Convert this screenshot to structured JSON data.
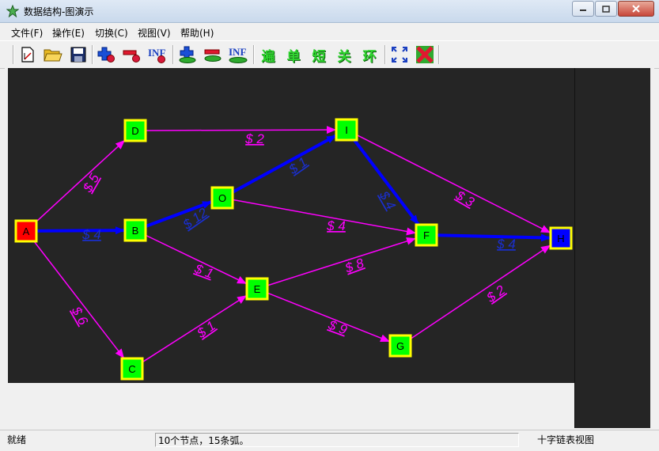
{
  "window": {
    "title": "数据结构-图演示",
    "app_icon": "green-star-icon",
    "buttons": {
      "minimize": "minimize-icon",
      "maximize": "maximize-icon",
      "close": "close-icon"
    }
  },
  "menu": [
    {
      "label": "文件(F)"
    },
    {
      "label": "操作(E)"
    },
    {
      "label": "切换(C)"
    },
    {
      "label": "视图(V)"
    },
    {
      "label": "帮助(H)"
    }
  ],
  "toolbar": {
    "text_buttons": {
      "traverse": "遍",
      "single": "单",
      "shortest": "短",
      "critical": "关",
      "cycle": "环"
    },
    "inf_label": "INF"
  },
  "graph": {
    "colors": {
      "background": "#252525",
      "edge_normal": "#ff00ff",
      "edge_highlight": "#0000ff",
      "node_fill": "#00ff00",
      "node_border": "#ffff00",
      "node_start": "#ff0000",
      "node_end": "#0000ff"
    },
    "nodes": [
      {
        "id": "A",
        "role": "start"
      },
      {
        "id": "B",
        "role": "normal"
      },
      {
        "id": "C",
        "role": "normal"
      },
      {
        "id": "D",
        "role": "normal"
      },
      {
        "id": "E",
        "role": "normal"
      },
      {
        "id": "F",
        "role": "normal"
      },
      {
        "id": "G",
        "role": "normal"
      },
      {
        "id": "H",
        "role": "end"
      },
      {
        "id": "I",
        "role": "normal"
      },
      {
        "id": "O",
        "role": "normal"
      }
    ],
    "edges": [
      {
        "from": "A",
        "to": "D",
        "label": "$ 5",
        "highlight": false
      },
      {
        "from": "A",
        "to": "B",
        "label": "$ 4",
        "highlight": true
      },
      {
        "from": "A",
        "to": "C",
        "label": "$ 6",
        "highlight": false
      },
      {
        "from": "D",
        "to": "I",
        "label": "$ 2",
        "highlight": false
      },
      {
        "from": "B",
        "to": "O",
        "label": "$ 12",
        "highlight": true
      },
      {
        "from": "B",
        "to": "E",
        "label": "$ 1",
        "highlight": false
      },
      {
        "from": "C",
        "to": "E",
        "label": "$ 1",
        "highlight": false
      },
      {
        "from": "O",
        "to": "I",
        "label": "$ 1",
        "highlight": true
      },
      {
        "from": "O",
        "to": "F",
        "label": "$ 4",
        "highlight": false
      },
      {
        "from": "I",
        "to": "F",
        "label": "$ 4",
        "highlight": true
      },
      {
        "from": "I",
        "to": "H",
        "label": "$ 3",
        "highlight": false
      },
      {
        "from": "E",
        "to": "F",
        "label": "$ 8",
        "highlight": false
      },
      {
        "from": "E",
        "to": "G",
        "label": "$ 9",
        "highlight": false
      },
      {
        "from": "F",
        "to": "H",
        "label": "$ 4",
        "highlight": true
      },
      {
        "from": "G",
        "to": "H",
        "label": "$ 2",
        "highlight": false
      }
    ]
  },
  "status": {
    "ready": "就绪",
    "info": "10个节点，15条弧。",
    "view": "十字链表视图"
  }
}
